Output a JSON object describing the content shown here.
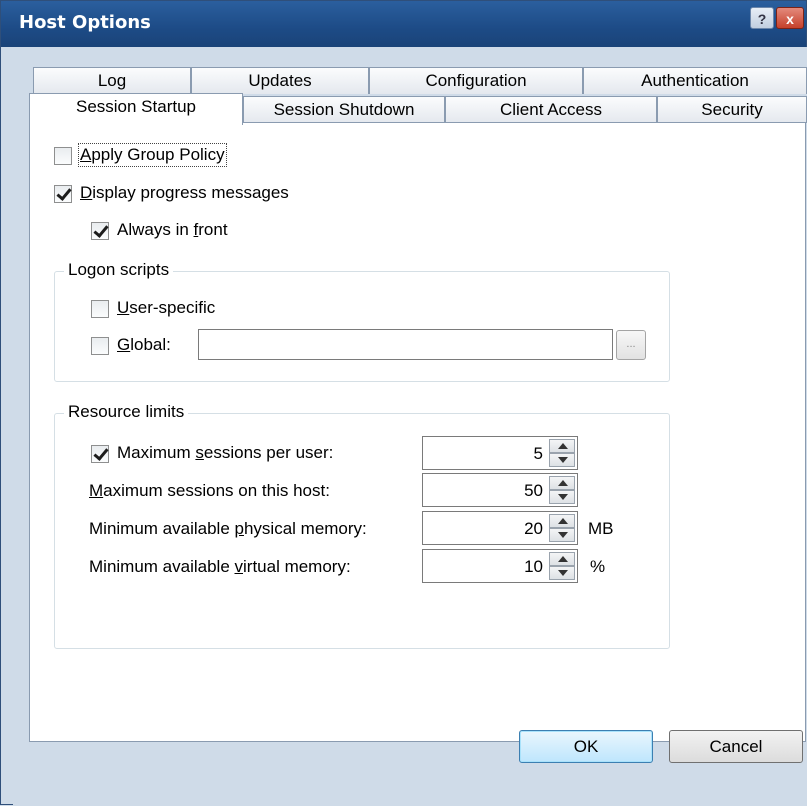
{
  "window": {
    "title": "Host Options",
    "help": "?",
    "close": "x"
  },
  "tabs": {
    "row1": [
      "Log",
      "Updates",
      "Configuration",
      "Authentication"
    ],
    "row2": [
      "Session Startup",
      "Session Shutdown",
      "Client Access",
      "Security"
    ],
    "active": "Session Startup"
  },
  "options": {
    "apply_group_policy": {
      "label_u": "A",
      "label_rest": "pply Group Policy",
      "checked": false
    },
    "display_progress": {
      "label_u": "D",
      "label_rest": "isplay progress messages",
      "checked": true
    },
    "always_in_front": {
      "label_pre": "Always in ",
      "label_u": "f",
      "label_rest": "ront",
      "checked": true
    }
  },
  "logon_scripts": {
    "title": "Logon scripts",
    "user_specific": {
      "label_u": "U",
      "label_rest": "ser-specific",
      "checked": false
    },
    "global": {
      "label_u": "G",
      "label_rest": "lobal:",
      "checked": false,
      "value": ""
    },
    "browse_label": "..."
  },
  "resource_limits": {
    "title": "Resource limits",
    "max_sessions_user": {
      "label_pre": "Maximum ",
      "label_u": "s",
      "label_rest": "essions per user:",
      "checked": true,
      "value": "5",
      "unit": ""
    },
    "max_sessions_host": {
      "label_pre": "",
      "label_u": "M",
      "label_rest": "aximum sessions on this host:",
      "value": "50",
      "unit": ""
    },
    "min_physical": {
      "label_pre": "Minimum available ",
      "label_u": "p",
      "label_rest": "hysical memory:",
      "value": "20",
      "unit": "MB"
    },
    "min_virtual": {
      "label_pre": "Minimum available ",
      "label_u": "v",
      "label_rest": "irtual memory:",
      "value": "10",
      "unit": "%"
    }
  },
  "buttons": {
    "ok": "OK",
    "cancel": "Cancel"
  }
}
